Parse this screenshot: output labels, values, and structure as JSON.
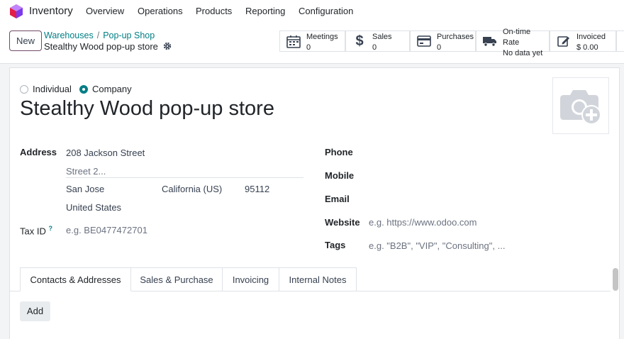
{
  "navbar": {
    "app_name": "Inventory",
    "menu": [
      "Overview",
      "Operations",
      "Products",
      "Reporting",
      "Configuration"
    ]
  },
  "control": {
    "new_label": "New",
    "breadcrumb": [
      "Warehouses",
      "Pop-up Shop"
    ],
    "record_title": "Stealthy Wood pop-up store",
    "smart_buttons": [
      {
        "title": "Meetings",
        "value": "0",
        "icon": "calendar-icon"
      },
      {
        "title": "Sales",
        "value": "0",
        "icon": "dollar-icon"
      },
      {
        "title": "Purchases",
        "value": "0",
        "icon": "credit-card-icon"
      },
      {
        "title": "On-time Rate",
        "value": "No data yet",
        "icon": "truck-icon"
      },
      {
        "title": "Invoiced",
        "value": "$ 0.00",
        "icon": "invoice-edit-icon"
      }
    ]
  },
  "form": {
    "type_options": [
      "Individual",
      "Company"
    ],
    "selected_type": "Company",
    "name": "Stealthy Wood pop-up store",
    "address_label": "Address",
    "street": "208 Jackson Street",
    "street2_placeholder": "Street 2...",
    "city": "San Jose",
    "state": "California (US)",
    "zip": "95112",
    "country": "United States",
    "tax_label": "Tax ID",
    "tax_help": "?",
    "tax_placeholder": "e.g. BE0477472701",
    "phone_label": "Phone",
    "mobile_label": "Mobile",
    "email_label": "Email",
    "website_label": "Website",
    "website_placeholder": "e.g. https://www.odoo.com",
    "tags_label": "Tags",
    "tags_placeholder": "e.g. \"B2B\", \"VIP\", \"Consulting\", ..."
  },
  "tabs": [
    "Contacts & Addresses",
    "Sales & Purchase",
    "Invoicing",
    "Internal Notes"
  ],
  "active_tab": "Contacts & Addresses",
  "add_label": "Add",
  "colors": {
    "brand": "#714b67",
    "accent": "#017e84"
  }
}
